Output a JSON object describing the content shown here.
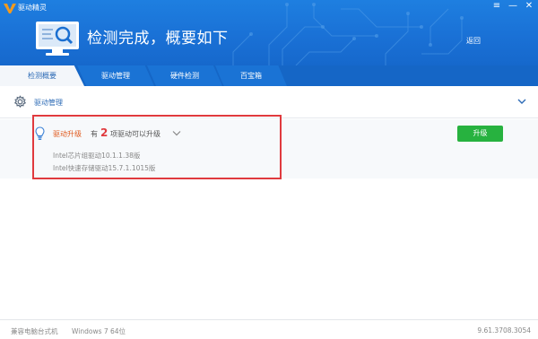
{
  "app": {
    "title": "驱动精灵"
  },
  "window_controls": {
    "menu": "≡",
    "minimize": "—",
    "close": "✕"
  },
  "header": {
    "status_title": "检测完成，概要如下",
    "back_label": "返回"
  },
  "tabs": [
    {
      "label": "检测概要",
      "active": true
    },
    {
      "label": "驱动管理",
      "active": false
    },
    {
      "label": "硬件检测",
      "active": false
    },
    {
      "label": "百宝箱",
      "active": false
    }
  ],
  "section": {
    "title": "驱动管理"
  },
  "update": {
    "label": "驱动升级",
    "prefix": "有",
    "count": "2",
    "suffix": "项驱动可以升级",
    "items": [
      "Intel芯片组驱动10.1.1.38版",
      "Intel快速存储驱动15.7.1.1015版"
    ],
    "button_label": "升级"
  },
  "footer": {
    "pc_type": "兼容电脑台式机",
    "os": "Windows 7 64位",
    "version": "9.61.3708.3054"
  },
  "colors": {
    "header_blue": "#1e7fe0",
    "tab_bar": "#1566c6",
    "accent_orange": "#e05a1e",
    "count_red": "#e03a3e",
    "highlight_border": "#e03a3e",
    "button_green": "#27b23f"
  }
}
